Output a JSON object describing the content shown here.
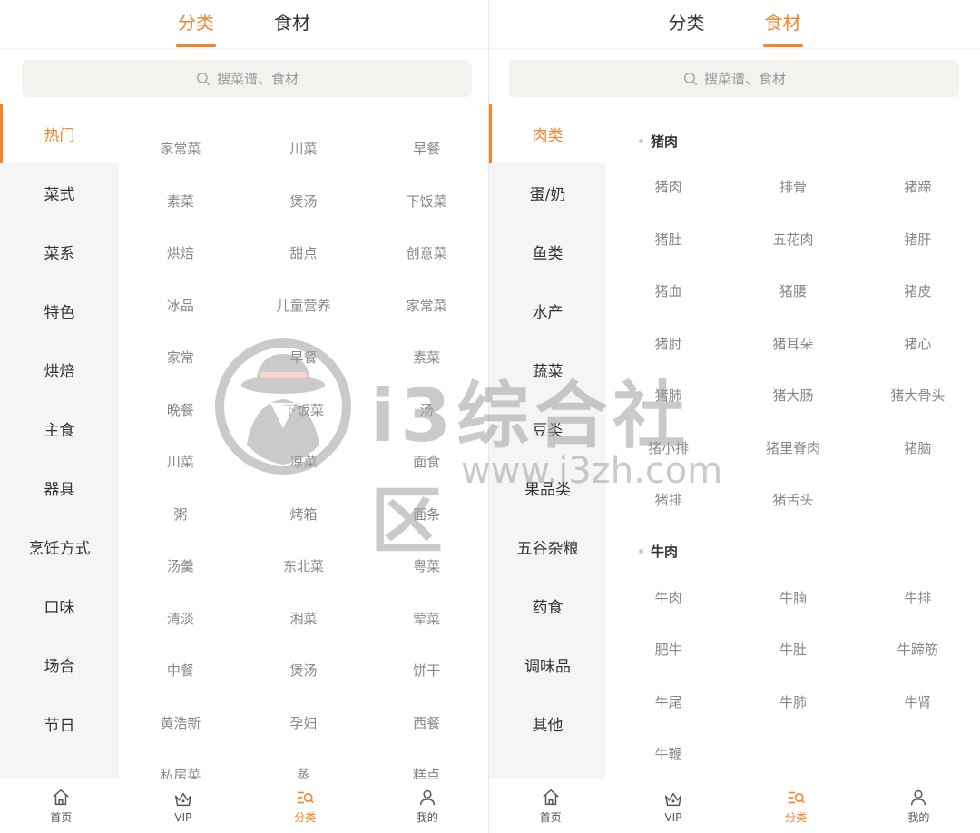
{
  "left": {
    "tabs": [
      {
        "label": "分类",
        "active": true
      },
      {
        "label": "食材",
        "active": false
      }
    ],
    "search_placeholder": "搜菜谱、食材",
    "sidebar": [
      "热门",
      "菜式",
      "菜系",
      "特色",
      "烘焙",
      "主食",
      "器具",
      "烹饪方式",
      "口味",
      "场合",
      "节日"
    ],
    "active_sidebar": "热门",
    "items": [
      "家常菜",
      "川菜",
      "早餐",
      "素菜",
      "煲汤",
      "下饭菜",
      "烘焙",
      "甜点",
      "创意菜",
      "冰品",
      "儿童营养",
      "家常菜",
      "家常",
      "早餐",
      "素菜",
      "晚餐",
      "下饭菜",
      "汤",
      "川菜",
      "凉菜",
      "面食",
      "粥",
      "烤箱",
      "面条",
      "汤羹",
      "东北菜",
      "粤菜",
      "清淡",
      "湘菜",
      "荤菜",
      "中餐",
      "煲汤",
      "饼干",
      "黄浩新",
      "孕妇",
      "西餐",
      "私房菜",
      "蒸",
      "糕点"
    ]
  },
  "right": {
    "tabs": [
      {
        "label": "分类",
        "active": false
      },
      {
        "label": "食材",
        "active": true
      }
    ],
    "search_placeholder": "搜菜谱、食材",
    "sidebar": [
      "肉类",
      "蛋/奶",
      "鱼类",
      "水产",
      "蔬菜",
      "豆类",
      "果品类",
      "五谷杂粮",
      "药食",
      "调味品",
      "其他"
    ],
    "active_sidebar": "肉类",
    "groups": [
      {
        "title": "猪肉",
        "items": [
          "猪肉",
          "排骨",
          "猪蹄",
          "猪肚",
          "五花肉",
          "猪肝",
          "猪血",
          "猪腰",
          "猪皮",
          "猪肘",
          "猪耳朵",
          "猪心",
          "猪肺",
          "猪大肠",
          "猪大骨头",
          "猪小排",
          "猪里脊肉",
          "猪脑",
          "猪排",
          "猪舌头"
        ]
      },
      {
        "title": "牛肉",
        "items": [
          "牛肉",
          "牛腩",
          "牛排",
          "肥牛",
          "牛肚",
          "牛蹄筋",
          "牛尾",
          "牛肺",
          "牛肾",
          "牛鞭"
        ]
      }
    ]
  },
  "bottom_nav": [
    {
      "label": "首页",
      "icon": "home-icon",
      "active": false
    },
    {
      "label": "VIP",
      "icon": "crown-icon",
      "active": false
    },
    {
      "label": "分类",
      "icon": "category-list-icon",
      "active": true
    },
    {
      "label": "我的",
      "icon": "user-icon",
      "active": false
    }
  ],
  "watermark": {
    "text": "i3综合社区",
    "url": "www.i3zh.com"
  },
  "colors": {
    "accent": "#f5852a",
    "sidebar_bg": "#f5f5f5",
    "search_bg": "#f3f2ee",
    "text_gray": "#888888"
  }
}
